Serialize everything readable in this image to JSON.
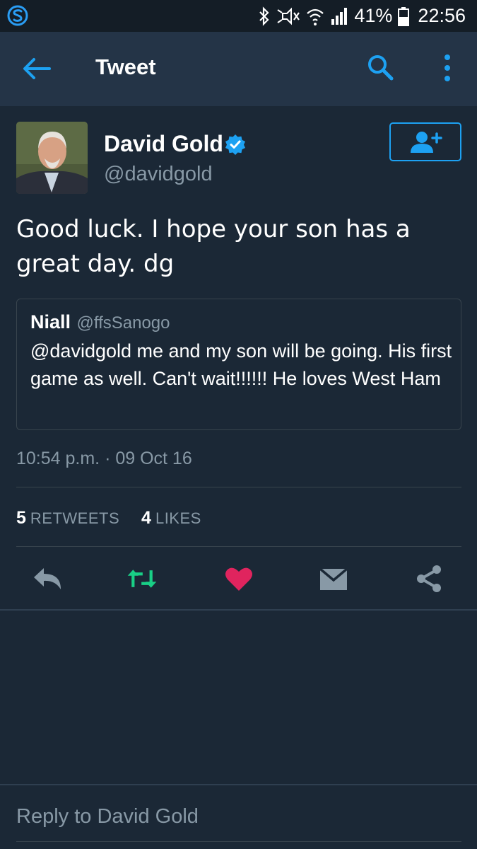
{
  "status_bar": {
    "app_icon": "skype-icon",
    "battery_percent": "41%",
    "time": "22:56"
  },
  "app_bar": {
    "title": "Tweet"
  },
  "tweet": {
    "author_name": "David Gold",
    "author_handle": "@davidgold",
    "text": "Good luck. I hope your son has a great day. dg",
    "quoted": {
      "name": "Niall",
      "handle": "@ffsSanogo",
      "text": "@davidgold me and my son will be going. His first game as well. Can't wait!!!!!! He loves West Ham"
    },
    "timestamp": "10:54 p.m. · 09 Oct 16",
    "retweets_count": "5",
    "retweets_label": "RETWEETS",
    "likes_count": "4",
    "likes_label": "LIKES"
  },
  "colors": {
    "background": "#1b2836",
    "app_bar": "#243447",
    "accent": "#1da1f2",
    "retweet": "#19cf86",
    "like": "#e0245e",
    "muted": "#8899a6"
  },
  "reply": {
    "placeholder": "Reply to David Gold"
  }
}
